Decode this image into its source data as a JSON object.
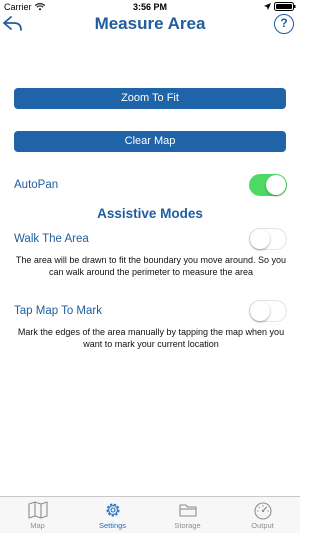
{
  "status_bar": {
    "carrier": "Carrier",
    "time": "3:56 PM"
  },
  "nav": {
    "title": "Measure Area",
    "back_icon": "back-arrow-icon",
    "help_label": "?"
  },
  "buttons": {
    "zoom_to_fit": "Zoom To Fit",
    "clear_map": "Clear Map"
  },
  "autopan": {
    "label": "AutoPan",
    "enabled": true
  },
  "assistive": {
    "title": "Assistive Modes",
    "walk_the_area": {
      "label": "Walk The Area",
      "enabled": false,
      "description": "The area will be drawn to fit the boundary you move around. So you can walk around the perimeter to measure the area"
    },
    "tap_map_to_mark": {
      "label": "Tap Map To Mark",
      "enabled": false,
      "description": "Mark the edges of the area manually by tapping the map when you want to mark your current location"
    }
  },
  "tabs": [
    {
      "label": "Map",
      "icon": "map-icon",
      "active": false
    },
    {
      "label": "Settings",
      "icon": "gear-icon",
      "active": true
    },
    {
      "label": "Storage",
      "icon": "folder-icon",
      "active": false
    },
    {
      "label": "Output",
      "icon": "gauge-icon",
      "active": false
    }
  ],
  "colors": {
    "accent": "#1f5e9e",
    "button": "#1f64a8",
    "toggle_on": "#4cd964",
    "tab_active": "#1f6fbf",
    "tab_inactive": "#8e8e93"
  }
}
